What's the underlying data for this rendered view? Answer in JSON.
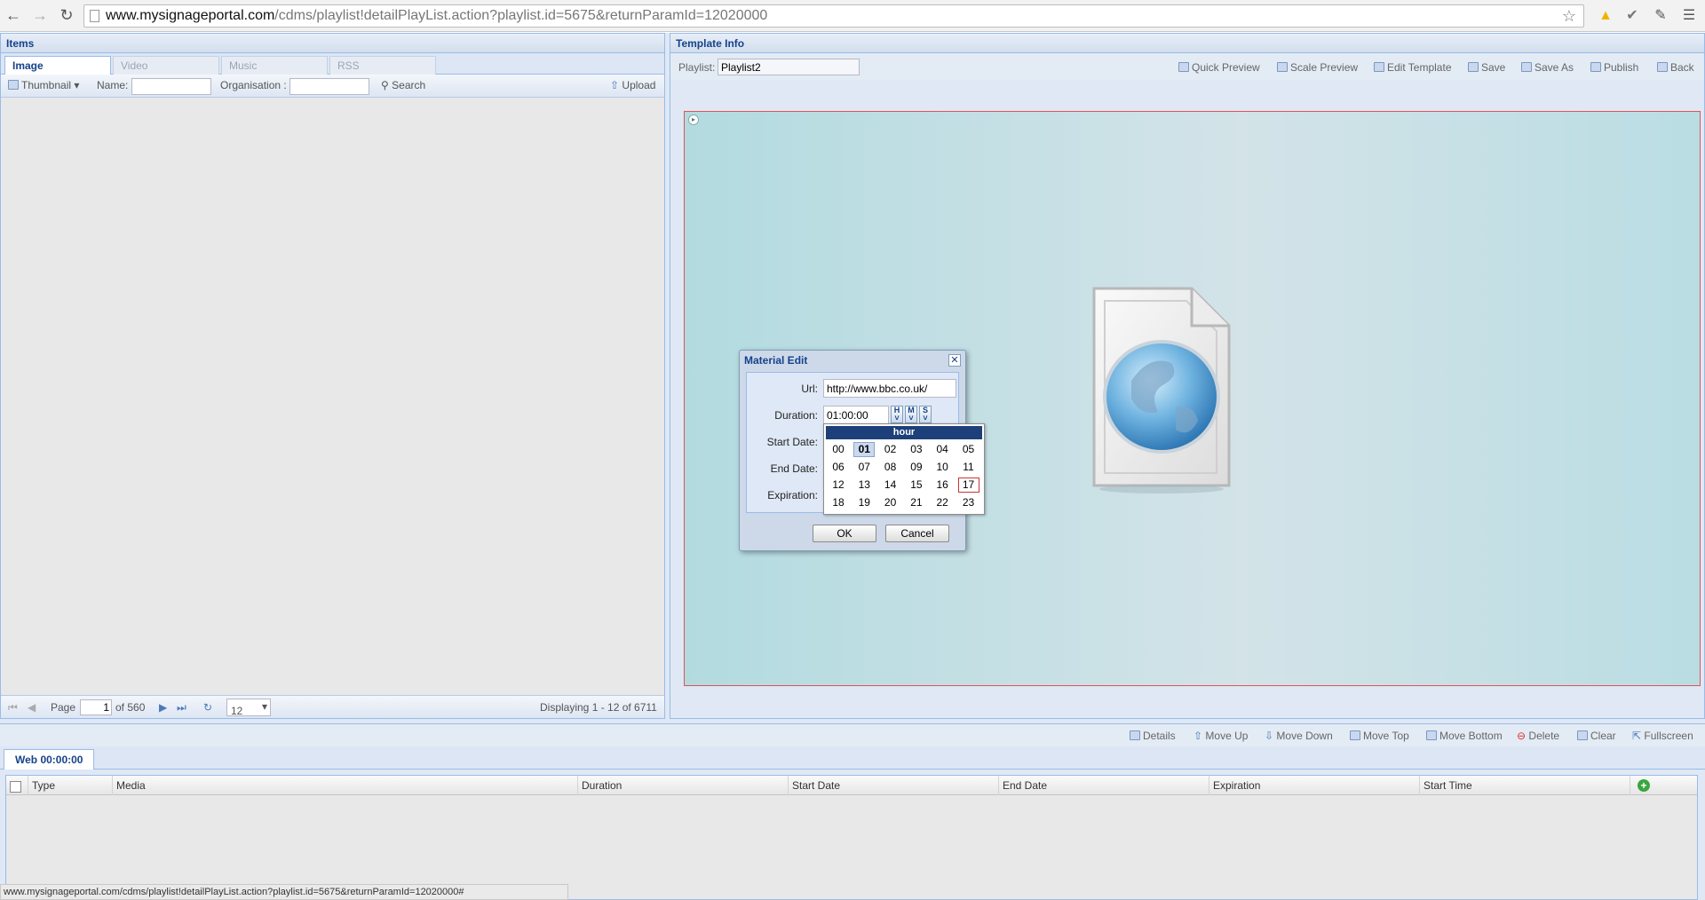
{
  "browser": {
    "url_host": "www.mysignageportal.com",
    "url_path": "/cdms/playlist!detailPlayList.action?playlist.id=5675&returnParamId=12020000"
  },
  "items_panel": {
    "title": "Items",
    "tabs": [
      "Image",
      "Video",
      "Music",
      "RSS"
    ],
    "active_tab": "Image",
    "toolbar": {
      "view_label": "Thumbnail",
      "name_label": "Name:",
      "name_value": "",
      "org_label": "Organisation :",
      "org_value": "",
      "search_label": "Search",
      "upload_label": "Upload"
    },
    "pager": {
      "page_label": "Page",
      "page_value": "1",
      "of_label": "of 560",
      "page_size": "12",
      "display_text": "Displaying 1 - 12 of 6711"
    }
  },
  "template_panel": {
    "title": "Template Info",
    "playlist_label": "Playlist:",
    "playlist_value": "Playlist2",
    "actions": [
      "Quick Preview",
      "Scale Preview",
      "Edit Template",
      "Save",
      "Save As",
      "Publish",
      "Back"
    ]
  },
  "bottom": {
    "actions": [
      "Details",
      "Move Up",
      "Move Down",
      "Move Top",
      "Move Bottom",
      "Delete",
      "Clear",
      "Fullscreen"
    ],
    "tab_label": "Web 00:00:00",
    "columns": [
      "Type",
      "Media",
      "Duration",
      "Start Date",
      "End Date",
      "Expiration",
      "Start Time"
    ]
  },
  "dialog": {
    "title": "Material Edit",
    "url_label": "Url:",
    "url_value": "http://www.bbc.co.uk/",
    "duration_label": "Duration:",
    "duration_value": "01:00:00",
    "start_date_label": "Start Date:",
    "end_date_label": "End Date:",
    "expiration_label": "Expiration:",
    "ok_label": "OK",
    "cancel_label": "Cancel",
    "hms": [
      "H",
      "M",
      "S"
    ]
  },
  "hour_picker": {
    "header": "hour",
    "hours": [
      "00",
      "01",
      "02",
      "03",
      "04",
      "05",
      "06",
      "07",
      "08",
      "09",
      "10",
      "11",
      "12",
      "13",
      "14",
      "15",
      "16",
      "17",
      "18",
      "19",
      "20",
      "21",
      "22",
      "23"
    ],
    "selected": "01",
    "current": "17"
  },
  "status_bar": {
    "text": "www.mysignageportal.com/cdms/playlist!detailPlayList.action?playlist.id=5675&returnParamId=12020000#"
  },
  "colors": {
    "header_text": "#15428b",
    "panel_border": "#99bbe8",
    "preview_bg": "#b2dbe0",
    "hour_header": "#1d3f7a"
  }
}
